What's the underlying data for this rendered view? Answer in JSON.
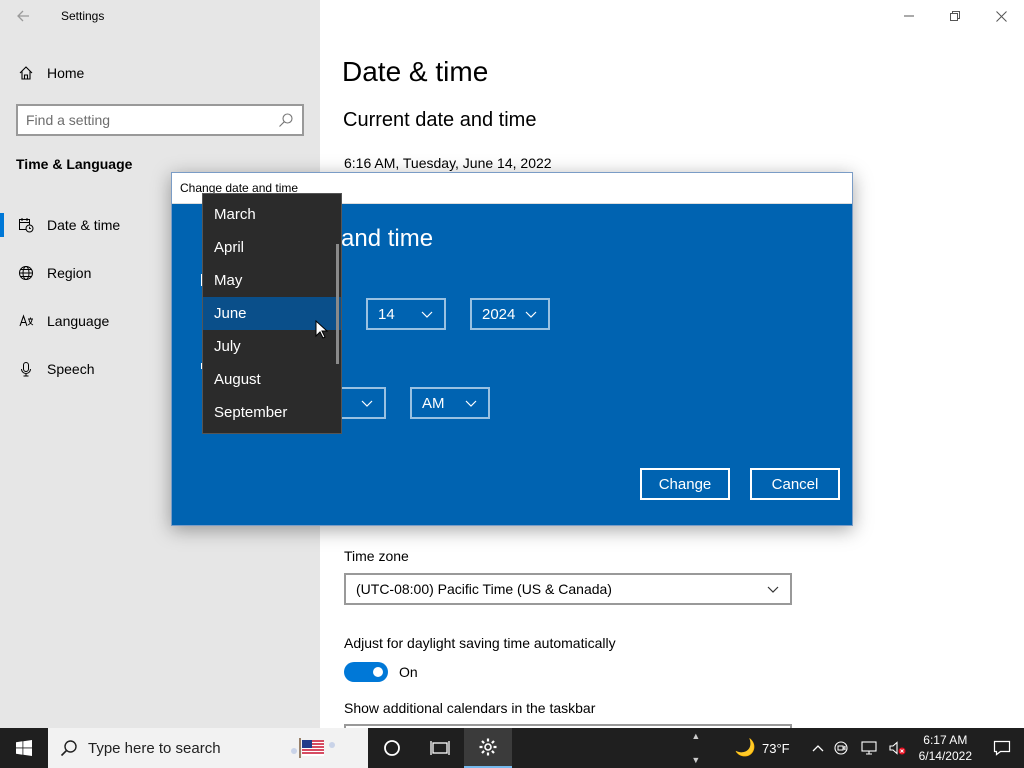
{
  "app": {
    "title": "Settings"
  },
  "sidebar": {
    "home_label": "Home",
    "search_placeholder": "Find a setting",
    "section_title": "Time & Language",
    "items": [
      {
        "label": "Date & time",
        "icon": "calendar-clock-icon",
        "active": true
      },
      {
        "label": "Region",
        "icon": "globe-icon",
        "active": false
      },
      {
        "label": "Language",
        "icon": "language-icon",
        "active": false
      },
      {
        "label": "Speech",
        "icon": "microphone-icon",
        "active": false
      }
    ]
  },
  "main": {
    "page_title": "Date & time",
    "subtitle": "Current date and time",
    "current_datetime": "6:16 AM, Tuesday, June 14, 2022",
    "timezone_label": "Time zone",
    "timezone_value": "(UTC-08:00) Pacific Time (US & Canada)",
    "dst_label": "Adjust for daylight saving time automatically",
    "dst_state": "On",
    "calendars_label": "Show additional calendars in the taskbar"
  },
  "dialog": {
    "title": "Change date and time",
    "heading_visible": "and time",
    "day_value": "14",
    "year_value": "2024",
    "ampm_value": "AM",
    "change_label": "Change",
    "cancel_label": "Cancel"
  },
  "month_dropdown": {
    "items": [
      "March",
      "April",
      "May",
      "June",
      "July",
      "August",
      "September"
    ],
    "selected": "June"
  },
  "taskbar": {
    "search_placeholder": "Type here to search",
    "weather": "73°F",
    "time": "6:17 AM",
    "date": "6/14/2022"
  },
  "colors": {
    "accent": "#0078d7",
    "dialog_bg": "#0063b1",
    "dropdown_bg": "#2b2b2b",
    "dropdown_selected": "#0a4f8a"
  }
}
